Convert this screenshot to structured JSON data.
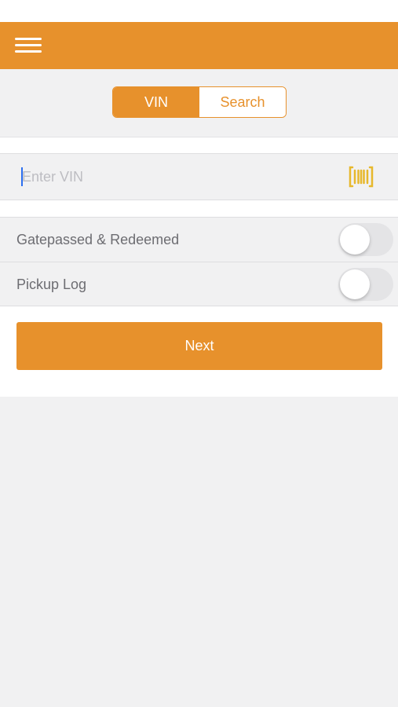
{
  "header": {
    "menu_icon": "hamburger-menu-icon",
    "accent_color": "#e7912c"
  },
  "segments": {
    "items": [
      {
        "label": "VIN",
        "active": true
      },
      {
        "label": "Search",
        "active": false
      }
    ]
  },
  "vin_input": {
    "placeholder": "Enter VIN",
    "value": "",
    "scan_icon": "barcode-scan-icon",
    "scan_icon_color": "#e7b82c"
  },
  "toggles": [
    {
      "label": "Gatepassed & Redeemed",
      "on": false
    },
    {
      "label": "Pickup Log",
      "on": false
    }
  ],
  "actions": {
    "next_label": "Next"
  }
}
